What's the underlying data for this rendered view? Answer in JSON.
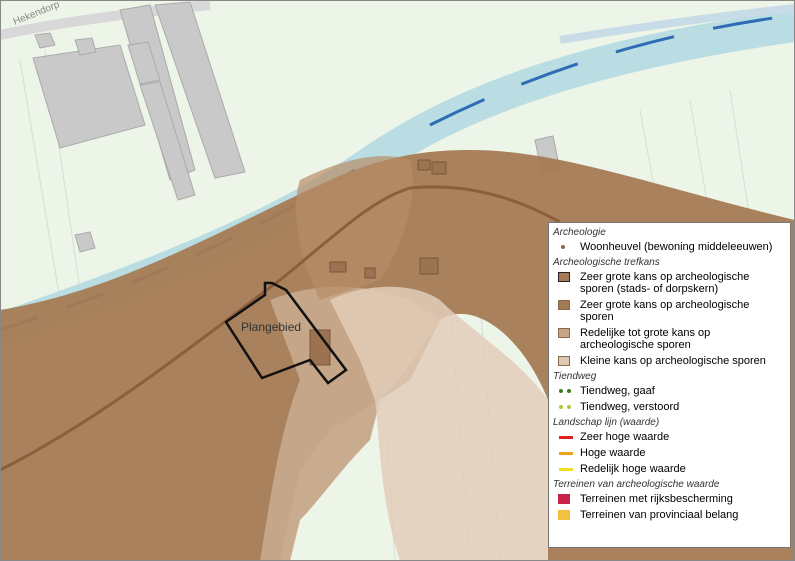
{
  "map": {
    "street_label": "Hekendorp",
    "area_label": "Plangebied"
  },
  "colors": {
    "meadow": "#eaf3e4",
    "water": "#a9d4df",
    "water_line": "#3e78b8",
    "building": "#c8c8c8",
    "zeer_groot": "#a47a55",
    "redelijk": "#c9a584",
    "klein": "#dfc9b4",
    "dijk": "#8c5e3c",
    "tiendweg_gaaf": "#3d7a27",
    "tiendweg_verstoord": "#a9c93a",
    "zeer_hoog": "#e02020",
    "hoog": "#f0a020",
    "redelijk_hoog": "#f0e020",
    "rijks": "#c8234a",
    "provinciaal": "#f4c040"
  },
  "legend": {
    "sections": [
      {
        "header": "Archeologie",
        "items": [
          {
            "symbol": "dot-brown",
            "label": "Woonheuvel (bewoning middeleeuwen)"
          }
        ]
      },
      {
        "header": "Archeologische trefkans",
        "items": [
          {
            "symbol": "swatch-dark",
            "label": "Zeer grote kans op archeologische sporen (stads- of dorpskern)"
          },
          {
            "symbol": "swatch-brown",
            "label": "Zeer grote kans op archeologische sporen"
          },
          {
            "symbol": "swatch-tan",
            "label": "Redelijke tot grote kans op archeologische sporen"
          },
          {
            "symbol": "swatch-light",
            "label": "Kleine kans op archeologische sporen"
          }
        ]
      },
      {
        "header": "Tiendweg",
        "items": [
          {
            "symbol": "dots-green",
            "label": "Tiendweg, gaaf"
          },
          {
            "symbol": "dots-lime",
            "label": "Tiendweg, verstoord"
          }
        ]
      },
      {
        "header": "Landschap lijn (waarde)",
        "items": [
          {
            "symbol": "line-red",
            "label": "Zeer hoge waarde"
          },
          {
            "symbol": "line-orange",
            "label": "Hoge waarde"
          },
          {
            "symbol": "line-yellow",
            "label": "Redelijk hoge waarde"
          }
        ]
      },
      {
        "header": "Terreinen van archeologische waarde",
        "items": [
          {
            "symbol": "fill-crimson",
            "label": "Terreinen met rijksbescherming"
          },
          {
            "symbol": "fill-orange",
            "label": "Terreinen van provinciaal belang"
          }
        ]
      }
    ]
  }
}
